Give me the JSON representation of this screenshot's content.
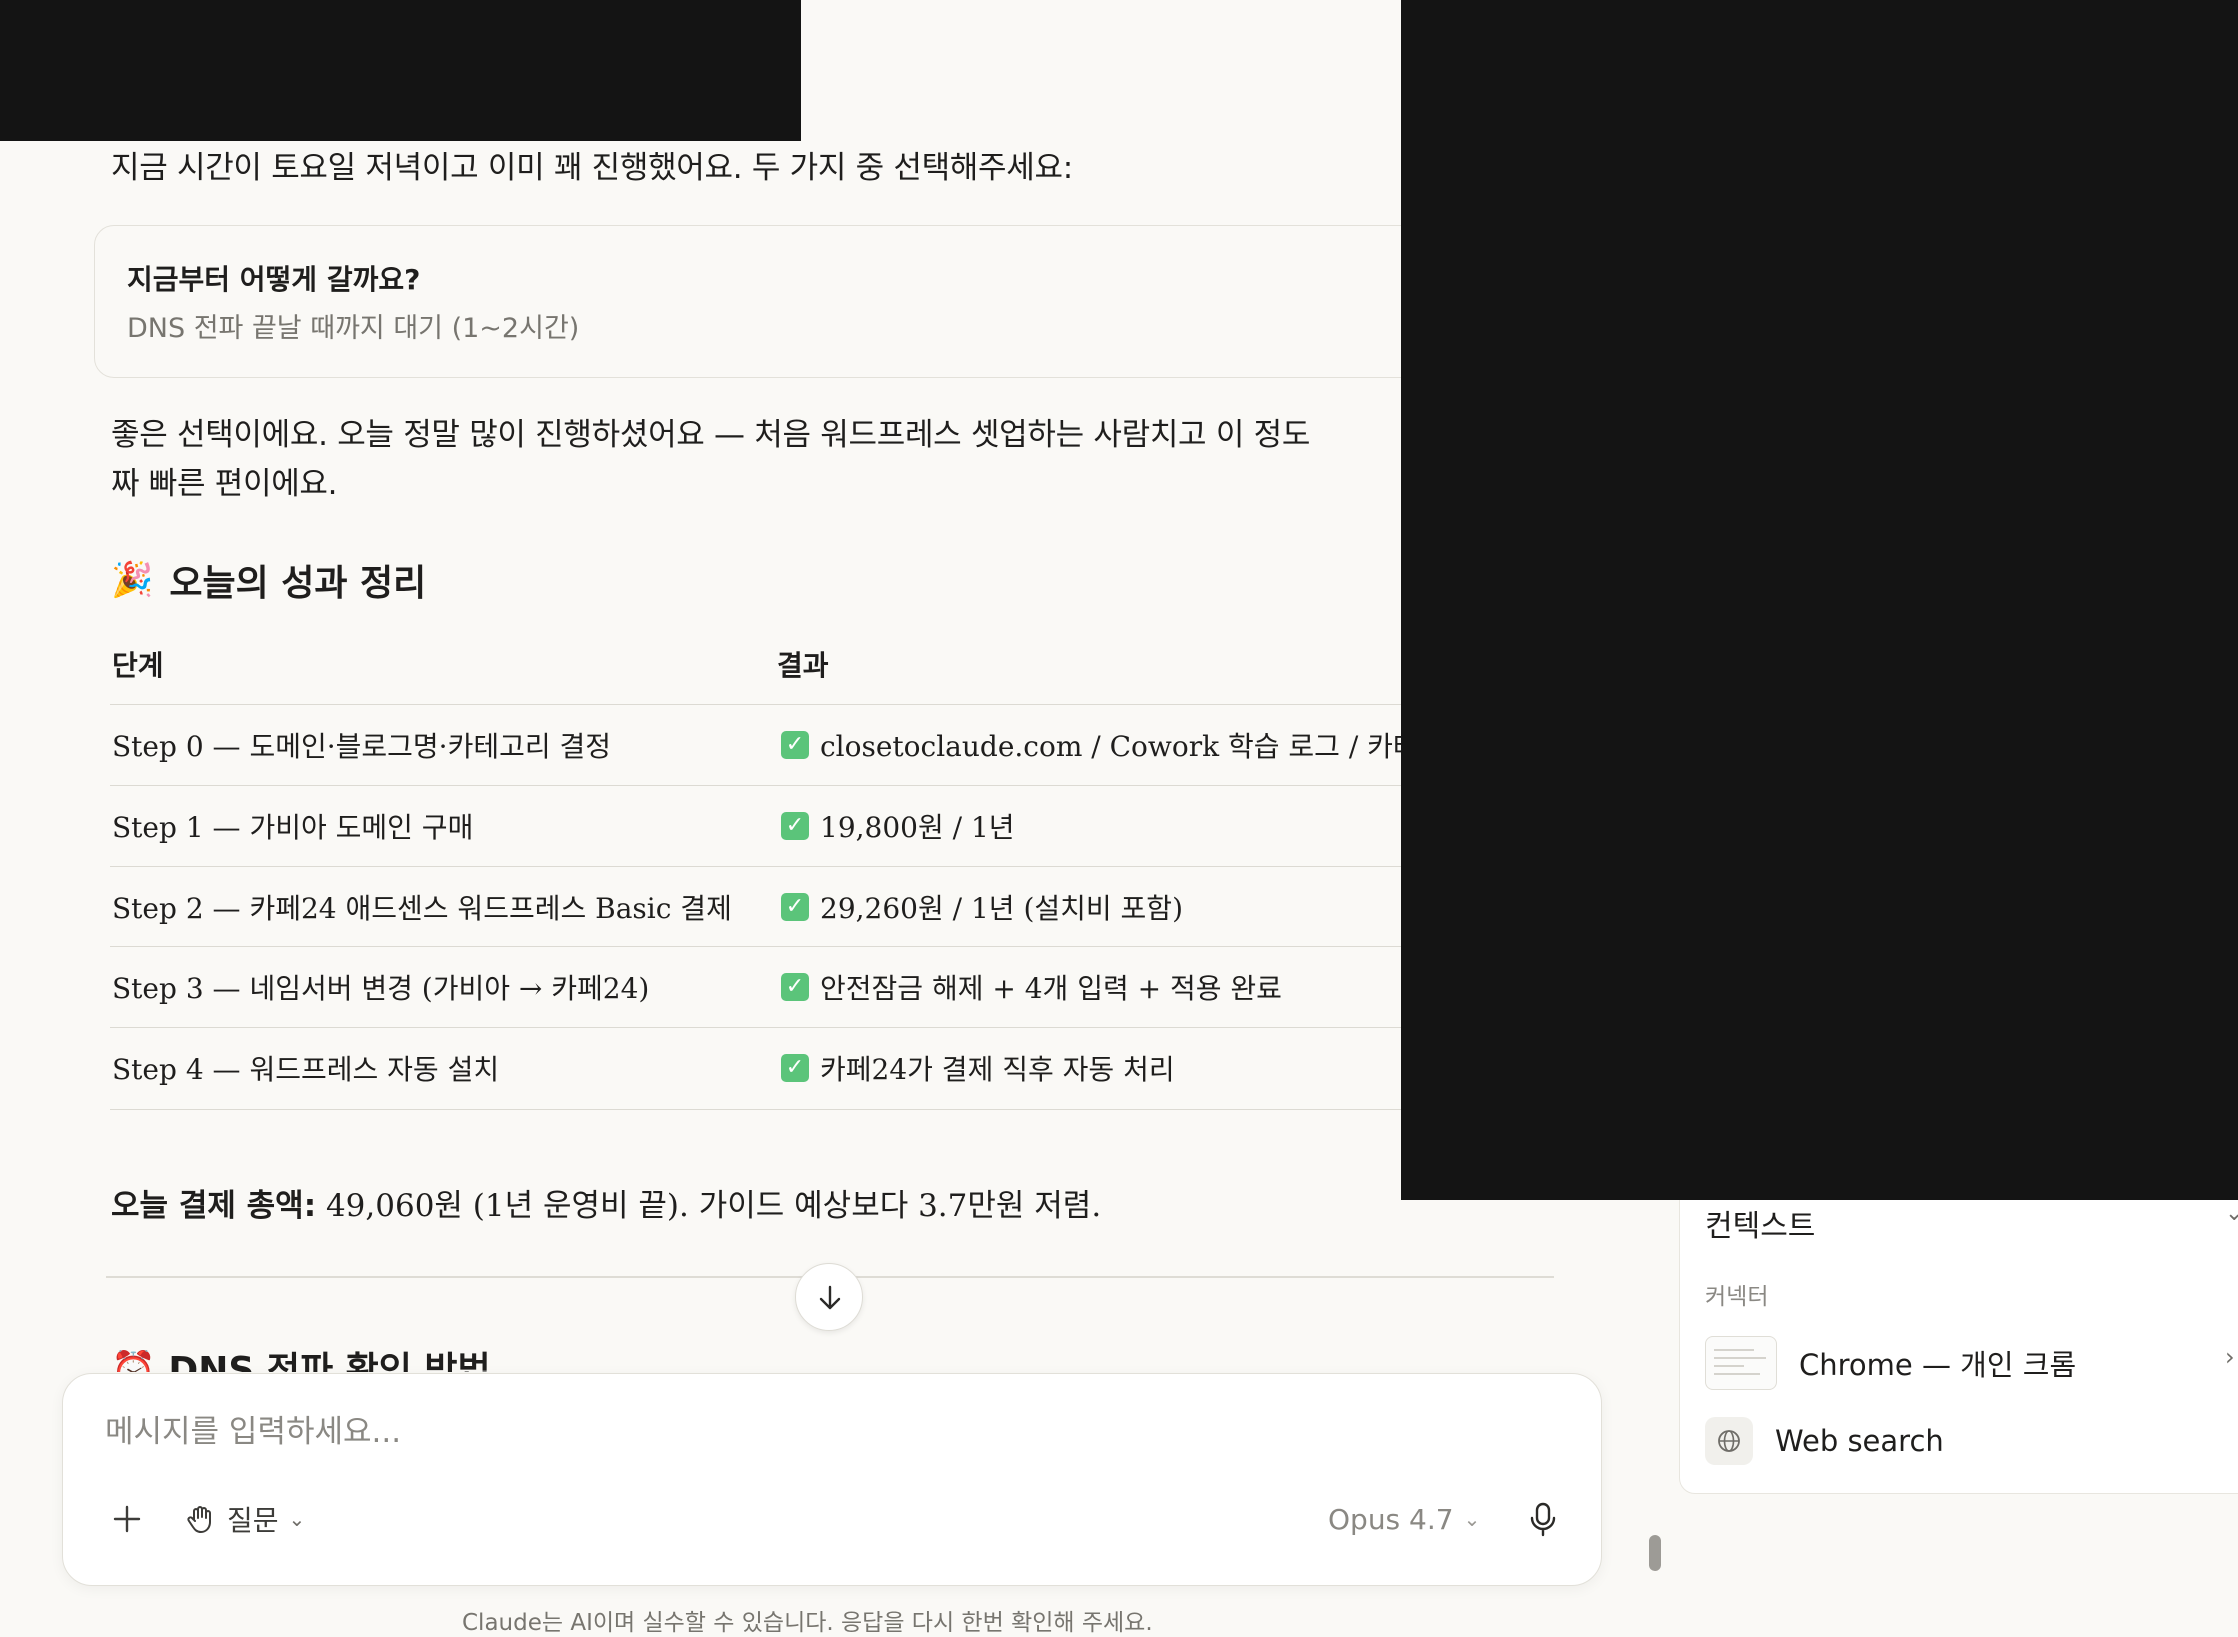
{
  "chat": {
    "intro": "지금 시간이 토요일 저녁이고 이미 꽤 진행했어요. 두 가지 중 선택해주세요:",
    "question_card": {
      "title": "지금부터 어떻게 갈까요?",
      "answer": "DNS 전파 끝날 때까지 대기 (1~2시간)"
    },
    "reply_line1": "좋은 선택이에요. 오늘 정말 많이 진행하셨어요 — 처음 워드프레스 셋업하는 사람치고 이 정도",
    "reply_line2": "짜 빠른 편이에요.",
    "summary_heading": {
      "emoji": "🎉",
      "text": "오늘의 성과 정리"
    },
    "table": {
      "headers": [
        "단계",
        "결과"
      ],
      "rows": [
        {
          "step": "Step 0 — 도메인·블로그명·카테고리 결정",
          "result": "closetoclaude.com / Cowork 학습 로그 / 카테고"
        },
        {
          "step": "Step 1 — 가비아 도메인 구매",
          "result": "19,800원 / 1년"
        },
        {
          "step": "Step 2 — 카페24 애드센스 워드프레스 Basic 결제",
          "result": "29,260원 / 1년 (설치비 포함)"
        },
        {
          "step": "Step 3 — 네임서버 변경 (가비아 → 카페24)",
          "result": "안전잠금 해제 + 4개 입력 + 적용 완료"
        },
        {
          "step": "Step 4 — 워드프레스 자동 설치",
          "result": "카페24가 결제 직후 자동 처리"
        }
      ],
      "check_glyph": "✓"
    },
    "total": {
      "label": "오늘 결제 총액:",
      "text": " 49,060원 (1년 운영비 끝). 가이드 예상보다 3.7만원 저렴."
    },
    "next_heading": {
      "emoji": "⏰",
      "text": "DNS 전파 확인 방법"
    }
  },
  "composer": {
    "placeholder": "메시지를 입력하세요...",
    "mode_label": "질문",
    "model_label": "Opus 4.7",
    "icons": {
      "add": "plus-icon",
      "mode": "hand-icon",
      "mic": "microphone-icon"
    }
  },
  "disclaimer": "Claude는 AI이며 실수할 수 있습니다. 응답을 다시 한번 확인해 주세요.",
  "side_panel": {
    "title": "컨텍스트",
    "section": "커넥터",
    "items": [
      {
        "label": "Chrome — 개인 크롬",
        "icon": "browser-thumbnail-icon"
      },
      {
        "label": "Web search",
        "icon": "globe-icon"
      }
    ]
  },
  "colors": {
    "background": "#faf9f6",
    "check": "#5bc47a",
    "redaction": "#141414"
  }
}
